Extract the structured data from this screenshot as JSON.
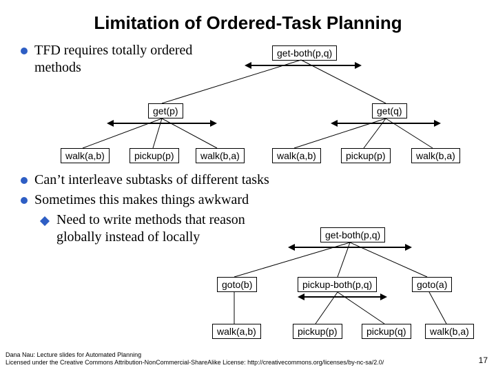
{
  "title": "Limitation of Ordered-Task Planning",
  "bullets": {
    "b1": "TFD requires totally ordered methods",
    "b2": "Can’t interleave subtasks of different tasks",
    "b3": "Sometimes this makes things awkward",
    "sub1": "Need to write methods that reason globally instead of locally"
  },
  "nodes": {
    "get_both": "get-both(p,q)",
    "get_p": "get(p)",
    "get_q": "get(q)",
    "walk_ab": "walk(a,b)",
    "pickup_p": "pickup(p)",
    "walk_ba": "walk(b,a)",
    "pickup_both": "pickup-both(p,q)",
    "goto_b": "goto(b)",
    "goto_a": "goto(a)",
    "pickup_q": "pickup(q)"
  },
  "footer": {
    "l1": "Dana Nau: Lecture slides for Automated Planning",
    "l2": "Licensed under the Creative Commons Attribution-NonCommercial-ShareAlike License: http://creativecommons.org/licenses/by-nc-sa/2.0/"
  },
  "page": "17"
}
